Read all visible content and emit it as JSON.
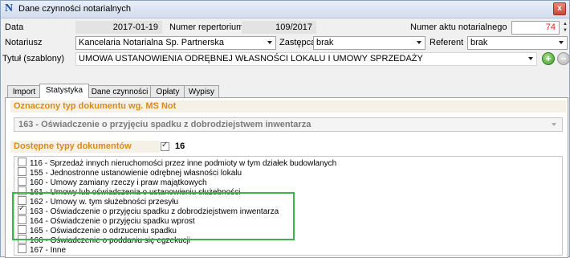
{
  "window": {
    "title": "Dane czynności notarialnych",
    "close_glyph": "x"
  },
  "form": {
    "data_label": "Data",
    "data_value": "2017-01-19",
    "repertorium_label": "Numer repertorium",
    "repertorium_value": "109/2017",
    "numer_aktu_label": "Numer aktu notarialnego",
    "numer_aktu_value": "74",
    "notariusz_label": "Notariusz",
    "notariusz_value": "Kancelaria Notarialna Sp. Partnerska",
    "zastepca_label": "Zastępca",
    "zastepca_value": "brak",
    "referent_label": "Referent",
    "referent_value": "brak",
    "tytul_label": "Tytuł (szablony)",
    "tytul_value": "UMOWA USTANOWIENIA ODRĘBNEJ WŁASNOŚCI LOKALU I UMOWY SPRZEDAŻY"
  },
  "tabs": [
    "Import",
    "Statystyka",
    "Dane czynności",
    "Opłaty",
    "Wypisy"
  ],
  "active_tab": "Statystyka",
  "statystyka": {
    "oznaczony_header": "Oznaczony typ dokumentu wg. MS Not",
    "oznaczony_value": "163 - Oświadczenie o przyjęciu spadku z dobrodziejstwem inwentarza",
    "dostepne_header": "Dostępne typy dokumentów",
    "dostepne_count": "16",
    "items": [
      {
        "label": "116 - Sprzedaż innych nieruchomości przez inne podmioty w tym działek budowlanych",
        "checked": false
      },
      {
        "label": "155 - Jednostronne ustanowienie odrębnej własności lokalu",
        "checked": false
      },
      {
        "label": "160 - Umowy zamiany rzeczy i praw majątkowych",
        "checked": false
      },
      {
        "label": "161 - Umowy lub oświadczenia o ustanowieniu służebności",
        "checked": false
      },
      {
        "label": "162 - Umowy        w. tym służebności przesyłu",
        "checked": false
      },
      {
        "label": "163 - Oświadczenie o przyjęciu spadku z dobrodziejstwem inwentarza",
        "checked": true
      },
      {
        "label": "164 - Oświadczenie o przyjęciu spadku wprost",
        "checked": false
      },
      {
        "label": "165 - Oświadczenie o odrzuceniu spadku",
        "checked": false
      },
      {
        "label": "166 - Oświadczenie o poddaniu się egzekucji",
        "checked": false
      },
      {
        "label": "167 - Inne",
        "checked": false
      }
    ]
  },
  "colors": {
    "section_header": "#d98a1a",
    "highlight_border": "#3bb54a",
    "numer_aktu_value": "#e02020"
  },
  "icons": [
    "app-n-icon",
    "close-icon",
    "add-icon",
    "remove-icon",
    "dropdown-arrow-icon",
    "spin-icon"
  ]
}
